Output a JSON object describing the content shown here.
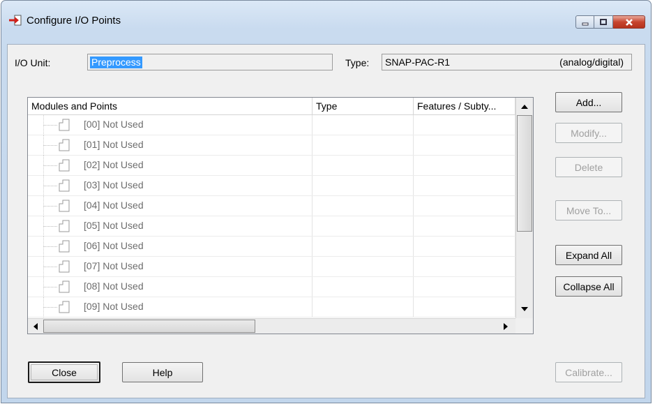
{
  "window": {
    "title": "Configure I/O Points",
    "icon": "configure-io-arrow-icon",
    "controls": [
      "minimize-icon",
      "maximize-icon",
      "close-icon"
    ],
    "close_color": "#c7452f"
  },
  "io_unit": {
    "label": "I/O Unit:",
    "value": "Preprocess"
  },
  "type_field": {
    "label": "Type:",
    "value": "SNAP-PAC-R1",
    "detail": "(analog/digital)"
  },
  "grid": {
    "columns": [
      "Modules and Points",
      "Type",
      "Features / Subty..."
    ],
    "rows": [
      {
        "label": "[00] Not Used",
        "type": "",
        "features": ""
      },
      {
        "label": "[01] Not Used",
        "type": "",
        "features": ""
      },
      {
        "label": "[02] Not Used",
        "type": "",
        "features": ""
      },
      {
        "label": "[03] Not Used",
        "type": "",
        "features": ""
      },
      {
        "label": "[04] Not Used",
        "type": "",
        "features": ""
      },
      {
        "label": "[05] Not Used",
        "type": "",
        "features": ""
      },
      {
        "label": "[06] Not Used",
        "type": "",
        "features": ""
      },
      {
        "label": "[07] Not Used",
        "type": "",
        "features": ""
      },
      {
        "label": "[08] Not Used",
        "type": "",
        "features": ""
      },
      {
        "label": "[09] Not Used",
        "type": "",
        "features": ""
      }
    ]
  },
  "buttons": {
    "add": "Add...",
    "modify": "Modify...",
    "delete": "Delete",
    "move_to": "Move To...",
    "expand_all": "Expand All",
    "collapse_all": "Collapse All",
    "close": "Close",
    "help": "Help",
    "calibrate": "Calibrate..."
  }
}
